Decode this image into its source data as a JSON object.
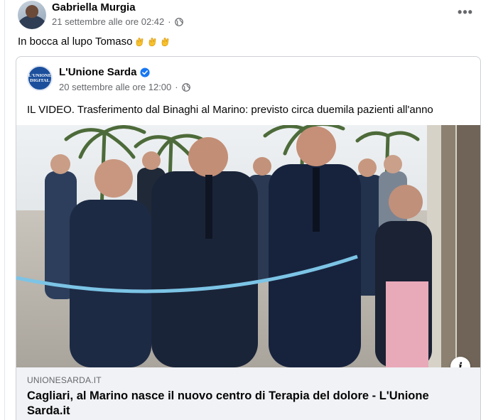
{
  "post": {
    "author": "Gabriella Murgia",
    "timestamp": "21 settembre alle ore 02:42",
    "privacy_icon": "globe-icon",
    "more_label": "•••",
    "text": "In bocca al lupo Tomaso",
    "emojis": [
      "clapping-hands",
      "clapping-hands",
      "clapping-hands"
    ]
  },
  "shared_post": {
    "page_name": "L'Unione Sarda",
    "logo_text_top": "L'UNIONE",
    "logo_text_bottom": "DIGITAL",
    "verified_icon": "verified-badge-icon",
    "timestamp": "20 settembre alle ore 12:00",
    "text": "IL VIDEO. Trasferimento dal Binaghi al Marino: previsto circa duemila pazienti all'anno",
    "info_label": "i"
  },
  "link_preview": {
    "domain": "UNIONESARDA.IT",
    "title": "Cagliari, al Marino nasce il nuovo centro di Terapia del dolore - L'Unione Sarda.it"
  },
  "colors": {
    "text_primary": "#050505",
    "text_secondary": "#65676b",
    "facebook_blue": "#1877f2",
    "footer_bg": "#f0f2f5",
    "ribbon": "#7cc4e6"
  }
}
